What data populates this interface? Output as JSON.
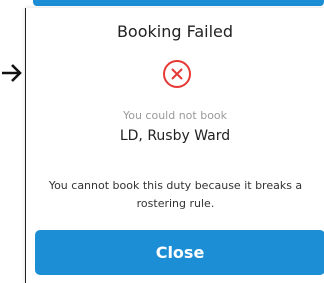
{
  "dialog": {
    "title": "Booking Failed",
    "icon": "error-x-circle-icon",
    "subtitle": "You could not book",
    "duty_name": "LD, Rusby Ward",
    "message": "You cannot book this duty because it breaks a rostering rule.",
    "close_label": "Close"
  },
  "pointer": {
    "icon": "arrow-right-icon"
  },
  "colors": {
    "accent": "#1c8ed6",
    "error": "#e53935",
    "muted_text": "#9a9a9a",
    "text": "#222222"
  }
}
